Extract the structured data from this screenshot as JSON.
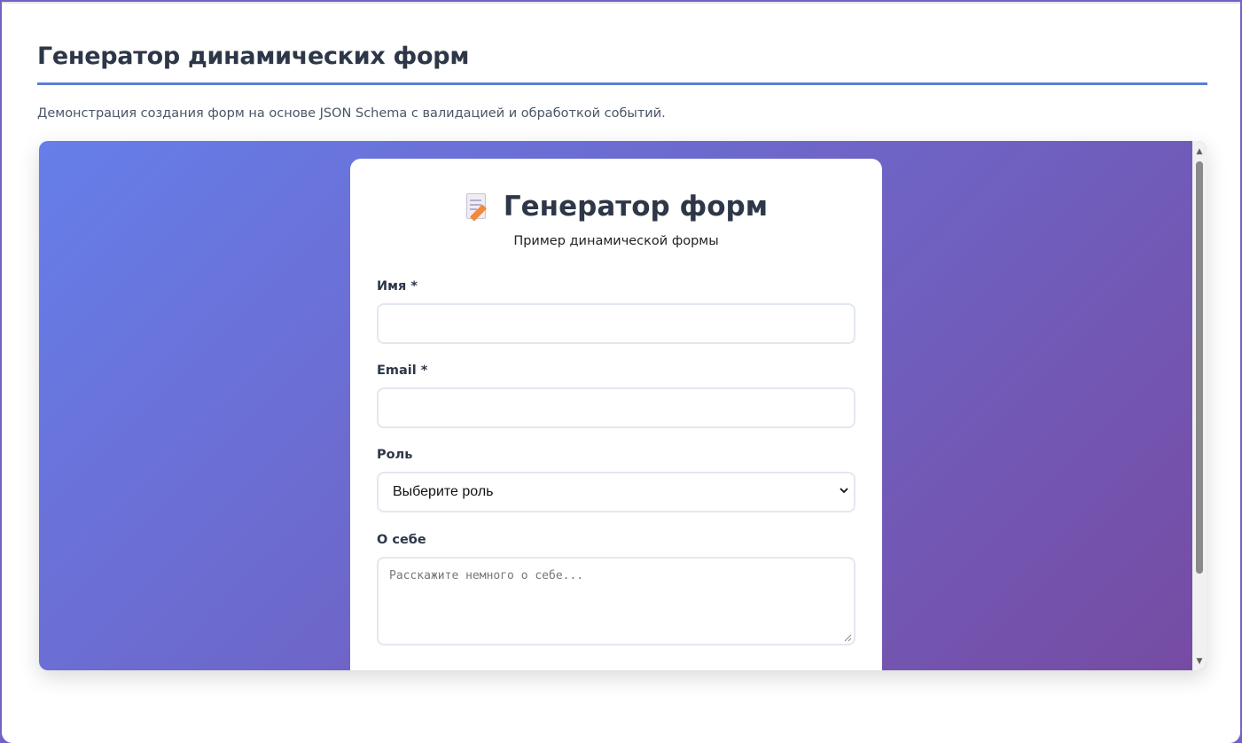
{
  "page": {
    "title": "Генератор динамических форм",
    "subtitle": "Демонстрация создания форм на основе JSON Schema с валидацией и обработкой событий."
  },
  "form": {
    "icon": "memo-icon",
    "title": "Генератор форм",
    "description": "Пример динамической формы",
    "fields": {
      "name": {
        "label": "Имя *",
        "value": ""
      },
      "email": {
        "label": "Email *",
        "value": ""
      },
      "role": {
        "label": "Роль",
        "selected": "Выберите роль"
      },
      "about": {
        "label": "О себе",
        "placeholder": "Расскажите немного о себе..."
      }
    }
  },
  "colors": {
    "gradient_start": "#667eea",
    "gradient_end": "#764ba2",
    "accent_rule": "#5b7fd6",
    "heading": "#2d3748"
  }
}
